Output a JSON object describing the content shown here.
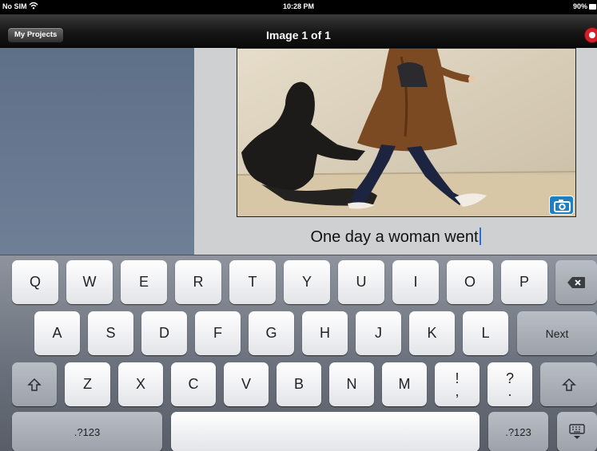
{
  "status_bar": {
    "carrier": "No SIM",
    "time": "10:28 PM",
    "battery": "90%",
    "icons": [
      "wifi-icon",
      "battery-icon"
    ]
  },
  "nav": {
    "back_label": "My Projects",
    "title": "Image 1 of 1",
    "record_icon": "record-icon"
  },
  "photo": {
    "camera_icon": "camera-icon"
  },
  "caption": {
    "text": "One day a woman went"
  },
  "keyboard": {
    "row1": [
      "Q",
      "W",
      "E",
      "R",
      "T",
      "Y",
      "U",
      "I",
      "O",
      "P"
    ],
    "backspace_icon": "backspace-icon",
    "row2": [
      "A",
      "S",
      "D",
      "F",
      "G",
      "H",
      "J",
      "K",
      "L"
    ],
    "next_label": "Next",
    "shift_icon": "shift-icon",
    "row3": [
      "Z",
      "X",
      "C",
      "V",
      "B",
      "N",
      "M"
    ],
    "punct_exclaim_top": "!",
    "punct_exclaim_bottom": ",",
    "punct_question_top": "?",
    "punct_question_bottom": ".",
    "numbers_label": ".?123",
    "dismiss_icon": "keyboard-dismiss-icon",
    "colors": {
      "key": "#ffffff",
      "function_key": "#aeb2b9",
      "background": "#6c727d"
    }
  }
}
